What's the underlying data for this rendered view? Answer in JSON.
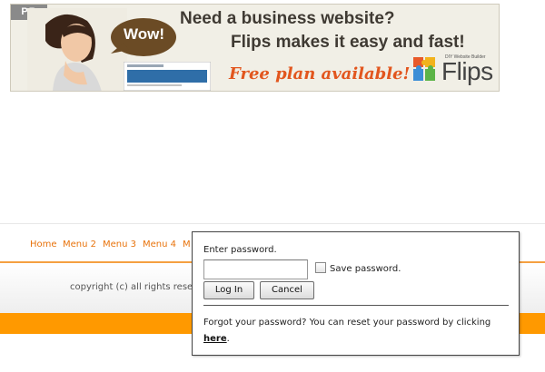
{
  "banner": {
    "pr_tag": "PR",
    "bubble_text": "Wow!",
    "headline_line1": "Need a business website?",
    "headline_line2": "Flips makes it easy and fast!",
    "free_plan": "Free plan available!",
    "brand_tagline": "DIY Website Builder",
    "brand_name": "Flips",
    "colors": {
      "accent_orange": "#e2561e",
      "bubble_brown": "#6b4b25"
    }
  },
  "nav": {
    "items": [
      "Home",
      "Menu 2",
      "Menu 3",
      "Menu 4",
      "M"
    ],
    "color": "#e8730c"
  },
  "footer": {
    "copyright": "copyright (c) all rights rese",
    "band_color": "#ff9900"
  },
  "login": {
    "prompt": "Enter password.",
    "password_value": "",
    "save_label": "Save password.",
    "save_checked": false,
    "login_button": "Log In",
    "cancel_button": "Cancel",
    "forgot_text": "Forgot your password? You can reset your password by clicking",
    "reset_link": "here",
    "trailing": "."
  }
}
